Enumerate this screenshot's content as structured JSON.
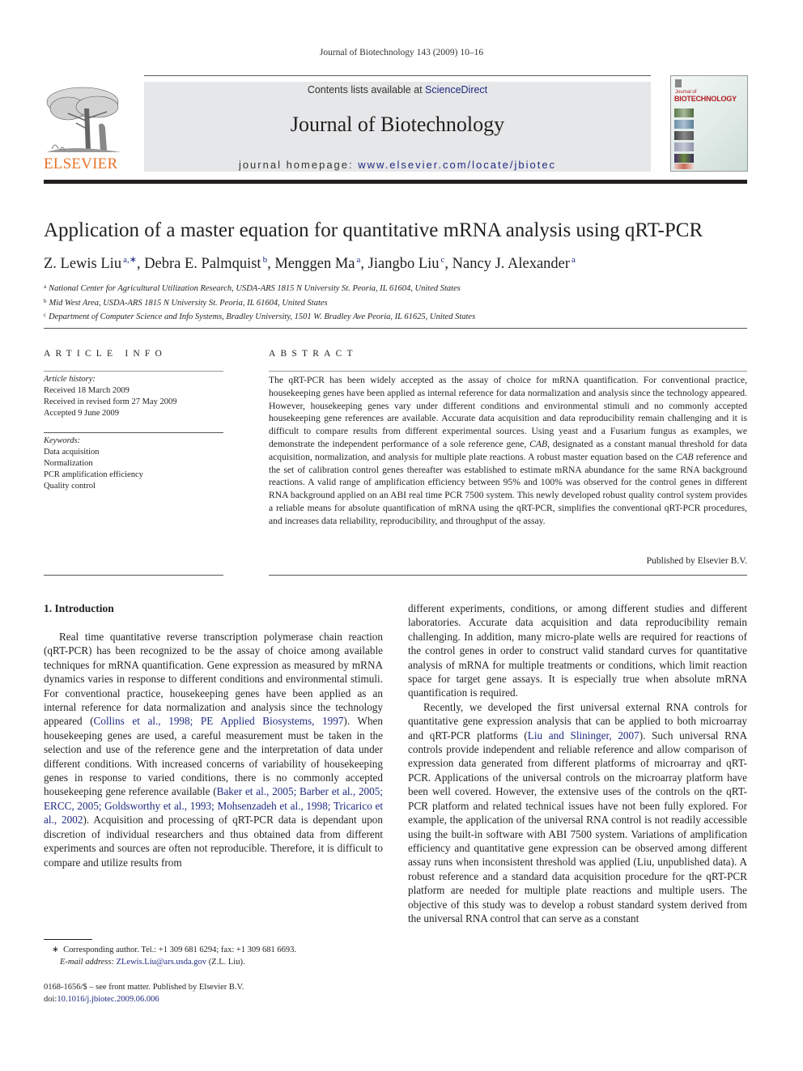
{
  "running_head": "Journal of Biotechnology 143 (2009) 10–16",
  "masthead": {
    "publisher_wordmark": "ELSEVIER",
    "contents_prefix": "Contents lists available at ",
    "contents_link": "ScienceDirect",
    "journal_title": "Journal of Biotechnology",
    "homepage_prefix": "journal homepage: ",
    "homepage_link": "www.elsevier.com/locate/jbiotec",
    "cover": {
      "line1": "Journal of",
      "line2": "BIOTECHNOLOGY"
    },
    "colors": {
      "elsevier_orange": "#e8742a",
      "link_blue": "#1f2a80",
      "masthead_gray": "#e6e7e8",
      "cover_red": "#b01c24"
    }
  },
  "article": {
    "title": "Application of a master equation for quantitative mRNA analysis using qRT-PCR",
    "authors": [
      {
        "name": "Z. Lewis Liu",
        "sup": "a,∗",
        "sep": ", "
      },
      {
        "name": "Debra E. Palmquist",
        "sup": "b",
        "sep": ", "
      },
      {
        "name": "Menggen Ma",
        "sup": "a",
        "sep": ", "
      },
      {
        "name": "Jiangbo Liu",
        "sup": "c",
        "sep": ", "
      },
      {
        "name": "Nancy J. Alexander",
        "sup": "a",
        "sep": ""
      }
    ],
    "affiliations": [
      {
        "key": "a",
        "text": "National Center for Agricultural Utilization Research, USDA-ARS 1815 N University St. Peoria, IL 61604, United States"
      },
      {
        "key": "b",
        "text": "Mid West Area, USDA-ARS 1815 N University St. Peoria, IL 61604, United States"
      },
      {
        "key": "c",
        "text": "Department of Computer Science and Info Systems, Bradley University, 1501 W. Bradley Ave Peoria, IL 61625, United States"
      }
    ]
  },
  "article_info": {
    "heading": "ARTICLE INFO",
    "history_label": "Article history:",
    "history": [
      "Received 18 March 2009",
      "Received in revised form 27 May 2009",
      "Accepted 9 June 2009"
    ],
    "keywords_label": "Keywords:",
    "keywords": [
      "Data acquisition",
      "Normalization",
      "PCR amplification efficiency",
      "Quality control"
    ]
  },
  "abstract": {
    "heading": "ABSTRACT",
    "part1": "The qRT-PCR has been widely accepted as the assay of choice for mRNA quantification. For conventional practice, housekeeping genes have been applied as internal reference for data normalization and analysis since the technology appeared. However, housekeeping genes vary under different conditions and environmental stimuli and no commonly accepted housekeeping gene references are available. Accurate data acquisition and data reproducibility remain challenging and it is difficult to compare results from different experimental sources. Using yeast and a Fusarium fungus as examples, we demonstrate the independent performance of a sole reference gene, ",
    "gene1": "CAB",
    "part2": ", designated as a constant manual threshold for data acquisition, normalization, and analysis for multiple plate reactions. A robust master equation based on the ",
    "gene2": "CAB",
    "part3": " reference and the set of calibration control genes thereafter was established to estimate mRNA abundance for the same RNA background reactions. A valid range of amplification efficiency between 95% and 100% was observed for the control genes in different RNA background applied on an ABI real time PCR 7500 system. This newly developed robust quality control system provides a reliable means for absolute quantification of mRNA using the qRT-PCR, simplifies the conventional qRT-PCR procedures, and increases data reliability, reproducibility, and throughput of the assay.",
    "publisher_note": "Published by Elsevier B.V."
  },
  "introduction": {
    "heading": "1.  Introduction",
    "p1_a": "Real time quantitative reverse transcription polymerase chain reaction (qRT-PCR) has been recognized to be the assay of choice among available techniques for mRNA quantification. Gene expression as measured by mRNA dynamics varies in response to different conditions and environmental stimuli. For conventional practice, housekeeping genes have been applied as an internal reference for data normalization and analysis since the technology appeared (",
    "cite1": "Collins et al., 1998; PE Applied Biosystems, 1997",
    "p1_b": "). When housekeeping genes are used, a careful measurement must be taken in the selection and use of the reference gene and the interpretation of data under different conditions. With increased concerns of variability of housekeeping genes in response to varied conditions, there is no commonly accepted housekeeping gene reference available (",
    "cite2": "Baker et al., 2005; Barber et al., 2005; ERCC, 2005; Goldsworthy et al., 1993; Mohsenzadeh et al., 1998; Tricarico et al., 2002",
    "p1_c": "). Acquisition and processing of qRT-PCR data is dependant upon discretion of individual researchers and thus obtained data from different experiments and sources are often not reproducible. Therefore, it is difficult to compare and utilize results from different experiments, conditions, or among different studies and different laboratories. Accurate data acquisition and data reproducibility remain challenging. In addition, many micro-plate wells are required for reactions of the control genes in order to construct valid standard curves for quantitative analysis of mRNA for multiple treatments or conditions, which limit reaction space for target gene assays. It is especially true when absolute mRNA quantification is required.",
    "p2_a": "Recently, we developed the first universal external RNA controls for quantitative gene expression analysis that can be applied to both microarray and qRT-PCR platforms (",
    "cite3": "Liu and Slininger, 2007",
    "p2_b": "). Such universal RNA controls provide independent and reliable reference and allow comparison of expression data generated from different platforms of microarray and qRT-PCR. Applications of the universal controls on the microarray platform have been well covered. However, the extensive uses of the controls on the qRT-PCR platform and related technical issues have not been fully explored. For example, the application of the universal RNA control is not readily accessible using the built-in software with ABI 7500 system. Variations of amplification efficiency and quantitative gene expression can be observed among different assay runs when inconsistent threshold was applied (Liu, unpublished data). A robust reference and a standard data acquisition procedure for the qRT-PCR platform are needed for multiple plate reactions and multiple users. The objective of this study was to develop a robust standard system derived from the universal RNA control that can serve as a constant"
  },
  "footnote": {
    "marker": "∗",
    "text": "Corresponding author. Tel.: +1 309 681 6294; fax: +1 309 681 6693.",
    "email_label": "E-mail address:",
    "email": "ZLewis.Liu@ars.usda.gov",
    "email_suffix": " (Z.L. Liu)."
  },
  "front_matter": {
    "issn_line": "0168-1656/$ – see front matter. Published by Elsevier B.V.",
    "doi_label": "doi:",
    "doi": "10.1016/j.jbiotec.2009.06.006"
  }
}
